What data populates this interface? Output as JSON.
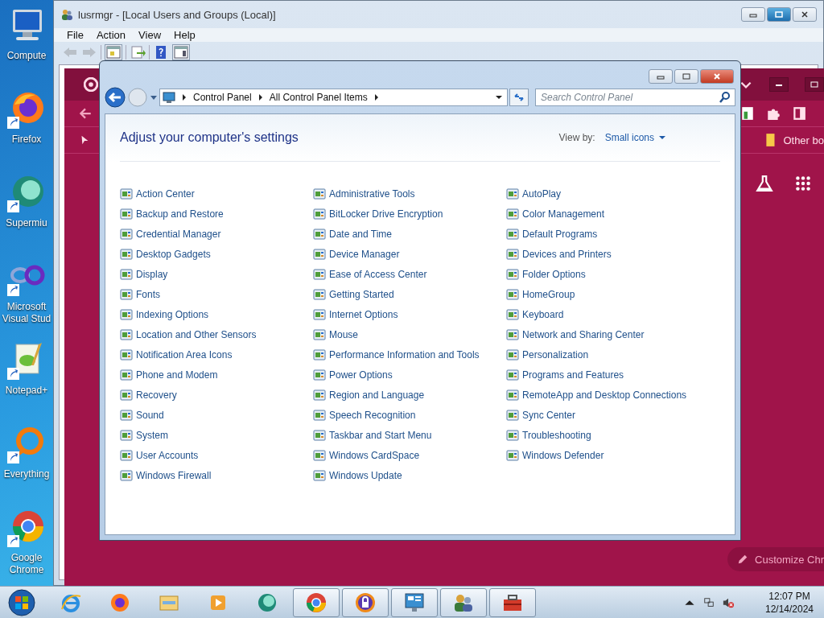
{
  "desktop_icons": [
    {
      "kind": "computer",
      "lines": [
        "Compute"
      ]
    },
    {
      "kind": "firefox",
      "lines": [
        "Firefox"
      ]
    },
    {
      "kind": "supermium",
      "lines": [
        "Supermiu"
      ]
    },
    {
      "kind": "visual-studio",
      "lines": [
        "Microsoft",
        "Visual Stud"
      ]
    },
    {
      "kind": "notepad",
      "lines": [
        "Notepad+"
      ]
    },
    {
      "kind": "everything",
      "lines": [
        "Everything"
      ]
    },
    {
      "kind": "chrome",
      "lines": [
        "Google",
        "Chrome"
      ]
    }
  ],
  "lusrmgr_window": {
    "title": "lusrmgr - [Local Users and Groups (Local)]",
    "menu": [
      "File",
      "Action",
      "View",
      "Help"
    ]
  },
  "browser_window": {
    "bookmark": "Other bo",
    "customize_button": "Customize Chr"
  },
  "control_panel": {
    "breadcrumb": [
      "Control Panel",
      "All Control Panel Items"
    ],
    "search": {
      "placeholder": "Search Control Panel"
    },
    "heading": "Adjust your computer's settings",
    "view_by_label": "View by:",
    "view_by_value": "Small icons",
    "columns": [
      [
        "Action Center",
        "Backup and Restore",
        "Credential Manager",
        "Desktop Gadgets",
        "Display",
        "Fonts",
        "Indexing Options",
        "Location and Other Sensors",
        "Notification Area Icons",
        "Phone and Modem",
        "Recovery",
        "Sound",
        "System",
        "User Accounts",
        "Windows Firewall"
      ],
      [
        "Administrative Tools",
        "BitLocker Drive Encryption",
        "Date and Time",
        "Device Manager",
        "Ease of Access Center",
        "Getting Started",
        "Internet Options",
        "Mouse",
        "Performance Information and Tools",
        "Power Options",
        "Region and Language",
        "Speech Recognition",
        "Taskbar and Start Menu",
        "Windows CardSpace",
        "Windows Update"
      ],
      [
        "AutoPlay",
        "Color Management",
        "Default Programs",
        "Devices and Printers",
        "Folder Options",
        "HomeGroup",
        "Keyboard",
        "Network and Sharing Center",
        "Personalization",
        "Programs and Features",
        "RemoteApp and Desktop Connections",
        "Sync Center",
        "Troubleshooting",
        "Windows Defender"
      ]
    ]
  },
  "taskbar": {
    "apps": [
      {
        "kind": "ie",
        "running": false
      },
      {
        "kind": "firefox",
        "running": false
      },
      {
        "kind": "explorer",
        "running": false
      },
      {
        "kind": "media",
        "running": false
      },
      {
        "kind": "supermium",
        "running": false
      },
      {
        "kind": "chrome",
        "running": true
      },
      {
        "kind": "lock",
        "running": true
      },
      {
        "kind": "control-panel",
        "running": true
      },
      {
        "kind": "users",
        "running": true
      },
      {
        "kind": "toolbox",
        "running": true
      }
    ],
    "clock": {
      "time": "12:07 PM",
      "date": "12/14/2024"
    }
  }
}
